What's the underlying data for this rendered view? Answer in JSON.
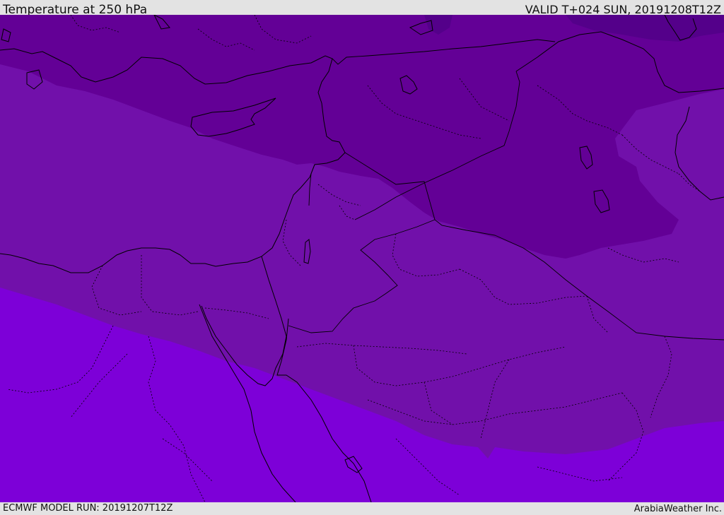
{
  "header": {
    "title": "Temperature at 250 hPa",
    "valid": "VALID T+024 SUN, 20191208T12Z"
  },
  "footer": {
    "model_run": "ECMWF MODEL RUN: 20191207T12Z",
    "credit": "ArabiaWeather Inc."
  },
  "map": {
    "field": "temperature",
    "level": "250 hPa",
    "colors": {
      "band_coldest": "#54008a",
      "band_cold": "#630096",
      "band_mid": "#7110aa",
      "band_warm": "#7d00d8",
      "coastline": "#000000",
      "border": "#000000"
    }
  }
}
